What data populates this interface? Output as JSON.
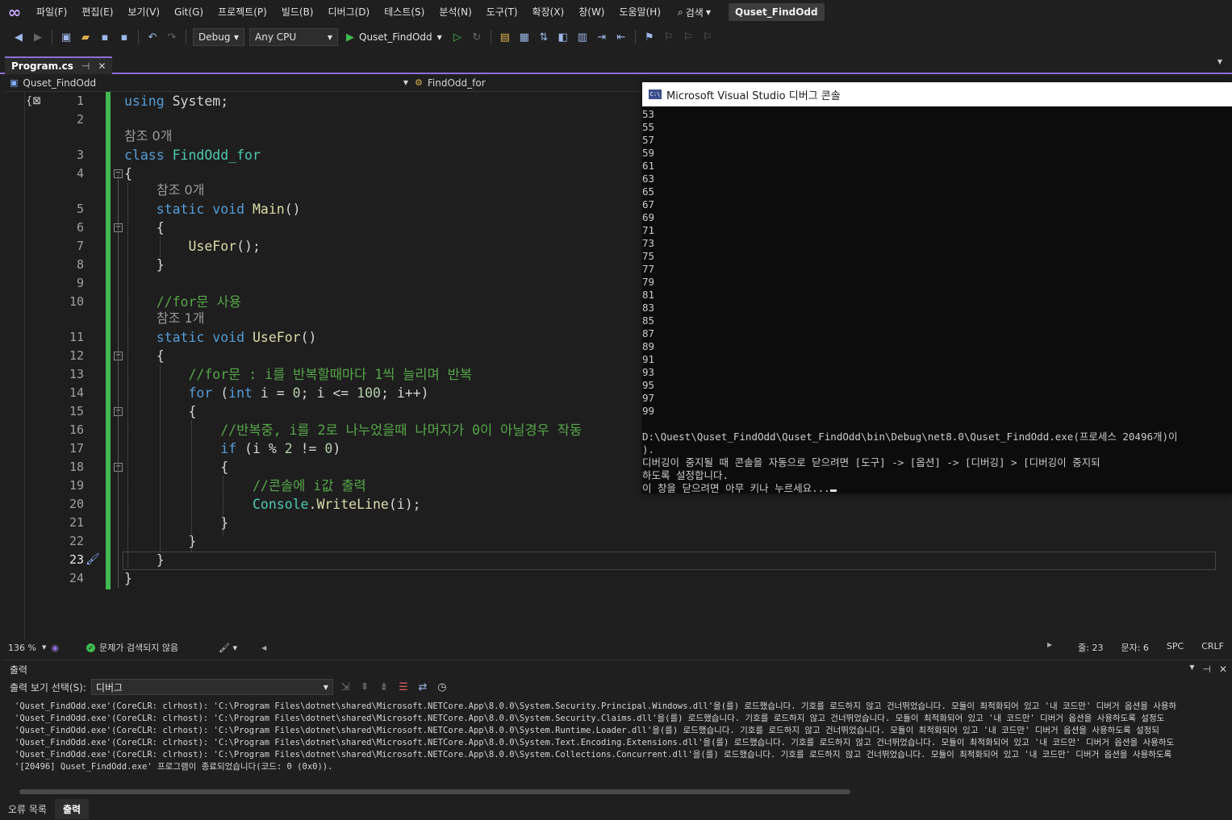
{
  "menu": {
    "items": [
      "파일(F)",
      "편집(E)",
      "보기(V)",
      "Git(G)",
      "프로젝트(P)",
      "빌드(B)",
      "디버그(D)",
      "테스트(S)",
      "분석(N)",
      "도구(T)",
      "확장(X)",
      "창(W)",
      "도움말(H)"
    ],
    "search_label": "검색",
    "solution_name": "Quset_FindOdd"
  },
  "toolbar": {
    "configuration": "Debug",
    "platform": "Any CPU",
    "run_target": "Quset_FindOdd"
  },
  "tabs": {
    "active_file": "Program.cs"
  },
  "navbar": {
    "project": "Quset_FindOdd",
    "class": "FindOdd_for",
    "member_partial": "UseFor()"
  },
  "editor": {
    "lines": [
      {
        "n": "1",
        "code": "using System;"
      },
      {
        "n": "2",
        "code": ""
      },
      {
        "n": "3",
        "code": "class FindOdd_for"
      },
      {
        "n": "4",
        "code": "{"
      },
      {
        "n": "5",
        "code": "    static void Main()"
      },
      {
        "n": "6",
        "code": "    {"
      },
      {
        "n": "7",
        "code": "        UseFor();"
      },
      {
        "n": "8",
        "code": "    }"
      },
      {
        "n": "9",
        "code": ""
      },
      {
        "n": "10",
        "code": "    //for문 사용"
      },
      {
        "n": "11",
        "code": "    static void UseFor()"
      },
      {
        "n": "12",
        "code": "    {"
      },
      {
        "n": "13",
        "code": "        //for문 : i를 반복할때마다 1씩 늘리며 반복"
      },
      {
        "n": "14",
        "code": "        for (int i = 0; i <= 100; i++)"
      },
      {
        "n": "15",
        "code": "        {"
      },
      {
        "n": "16",
        "code": "            //반복중, i를 2로 나누었을때 나머지가 0이 아닐경우 작동"
      },
      {
        "n": "17",
        "code": "            if (i % 2 != 0)"
      },
      {
        "n": "18",
        "code": "            {"
      },
      {
        "n": "19",
        "code": "                //콘솔에 i값 출력"
      },
      {
        "n": "20",
        "code": "                Console.WriteLine(i);"
      },
      {
        "n": "21",
        "code": "            }"
      },
      {
        "n": "22",
        "code": "        }"
      },
      {
        "n": "23",
        "code": "    }"
      },
      {
        "n": "24",
        "code": "}"
      }
    ],
    "codelens": {
      "class_refs": "참조 0개",
      "main_refs": "참조 0개",
      "usefor_refs": "참조 1개"
    }
  },
  "console": {
    "title": "Microsoft Visual Studio 디버그 콘솔",
    "output_numbers": [
      "53",
      "55",
      "57",
      "59",
      "61",
      "63",
      "65",
      "67",
      "69",
      "71",
      "73",
      "75",
      "77",
      "79",
      "81",
      "83",
      "85",
      "87",
      "89",
      "91",
      "93",
      "95",
      "97",
      "99"
    ],
    "exit_line1": "D:\\Quest\\Quset_FindOdd\\Quset_FindOdd\\bin\\Debug\\net8.0\\Quset_FindOdd.exe(프로세스 20496개)이",
    "exit_line2": ").",
    "hint_line1": "디버깅이 중지될 때 콘솔을 자동으로 닫으려면 [도구] -> [옵션] -> [디버깅] > [디버깅이 중지되",
    "hint_line2": "하도록 설정합니다.",
    "press_key": "이 창을 닫으려면 아무 키나 누르세요..."
  },
  "status": {
    "zoom": "136 %",
    "issues": "문제가 검색되지 않음",
    "line": "줄: 23",
    "char": "문자: 6",
    "whitespace": "SPC",
    "line_ending": "CRLF"
  },
  "output": {
    "title": "출력",
    "source_label": "출력 보기 선택(S):",
    "source_value": "디버그",
    "lines": [
      "'Quset_FindOdd.exe'(CoreCLR: clrhost): 'C:\\Program Files\\dotnet\\shared\\Microsoft.NETCore.App\\8.0.0\\System.Security.Principal.Windows.dll'을(를) 로드했습니다. 기호를 로드하지 않고 건너뛰었습니다. 모듈이 최적화되어 있고 '내 코드만' 디버거 옵션을 사용하",
      "'Quset_FindOdd.exe'(CoreCLR: clrhost): 'C:\\Program Files\\dotnet\\shared\\Microsoft.NETCore.App\\8.0.0\\System.Security.Claims.dll'을(를) 로드했습니다. 기호를 로드하지 않고 건너뛰었습니다. 모듈이 최적화되어 있고 '내 코드만' 디버거 옵션을 사용하도록 설정도",
      "'Quset_FindOdd.exe'(CoreCLR: clrhost): 'C:\\Program Files\\dotnet\\shared\\Microsoft.NETCore.App\\8.0.0\\System.Runtime.Loader.dll'을(를) 로드했습니다. 기호를 로드하지 않고 건너뛰었습니다. 모듈이 최적화되어 있고 '내 코드만' 디버거 옵션을 사용하도록 설정되",
      "'Quset_FindOdd.exe'(CoreCLR: clrhost): 'C:\\Program Files\\dotnet\\shared\\Microsoft.NETCore.App\\8.0.0\\System.Text.Encoding.Extensions.dll'을(를) 로드했습니다. 기호를 로드하지 않고 건너뛰었습니다. 모듈이 최적화되어 있고 '내 코드만' 디버거 옵션을 사용하도",
      "'Quset_FindOdd.exe'(CoreCLR: clrhost): 'C:\\Program Files\\dotnet\\shared\\Microsoft.NETCore.App\\8.0.0\\System.Collections.Concurrent.dll'을(를) 로드했습니다. 기호를 로드하지 않고 건너뛰었습니다. 모듈이 최적화되어 있고 '내 코드만' 디버거 옵션을 사용하도록",
      "'[20496] Quset_FindOdd.exe' 프로그램이 종료되었습니다(코드: 0 (0x0))."
    ]
  },
  "bottom_tabs": {
    "error_list": "오류 목록",
    "output": "출력"
  }
}
